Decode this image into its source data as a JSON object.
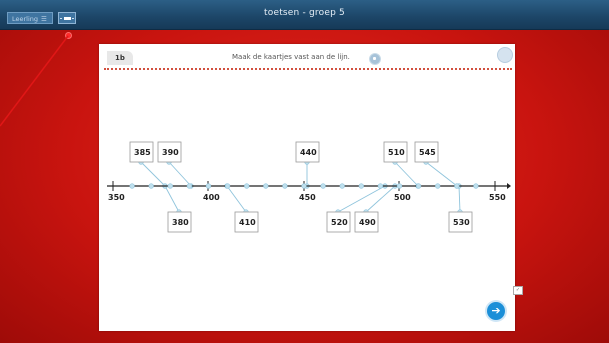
{
  "topbar": {
    "title": "toetsen - groep 5",
    "leerling_button": "Leerling",
    "leerling_menu_glyph": "☰"
  },
  "exercise": {
    "number": "1b",
    "instruction": "Maak de kaartjes vast aan de lijn."
  },
  "number_line": {
    "tick_labels": [
      "350",
      "400",
      "450",
      "500",
      "550"
    ],
    "cards_top": [
      "385",
      "390",
      "440",
      "510",
      "545"
    ],
    "cards_bottom": [
      "380",
      "410",
      "520",
      "490",
      "530"
    ]
  },
  "navigation": {
    "next_glyph": "➔",
    "check_glyph": "✓"
  },
  "colors": {
    "topbar": "#1c4567",
    "background": "#d3180f",
    "accent": "#1b8fd8",
    "line_connector": "#8fc4dc"
  }
}
